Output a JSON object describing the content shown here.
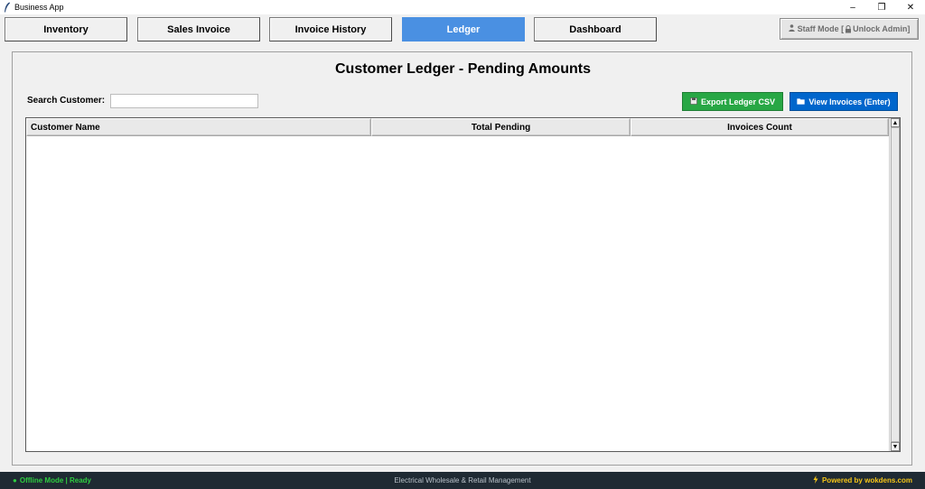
{
  "window": {
    "title": "Business App",
    "controls": {
      "minimize": "–",
      "restore": "❐",
      "close": "✕"
    }
  },
  "nav": {
    "tabs": [
      {
        "label": "Inventory",
        "active": false
      },
      {
        "label": "Sales Invoice",
        "active": false
      },
      {
        "label": "Invoice History",
        "active": false
      },
      {
        "label": "Ledger",
        "active": true
      },
      {
        "label": "Dashboard",
        "active": false
      }
    ],
    "staff_mode_label": "Staff Mode [",
    "unlock_label": " Unlock Admin]"
  },
  "main": {
    "title": "Customer Ledger - Pending Amounts",
    "search": {
      "label": "Search Customer:",
      "value": ""
    },
    "export_label": "Export Ledger CSV",
    "view_label": "View Invoices (Enter)",
    "table": {
      "columns": [
        "Customer Name",
        "Total Pending",
        "Invoices Count"
      ],
      "rows": []
    }
  },
  "footer": {
    "status": "Offline Mode | Ready",
    "center": "Electrical Wholesale & Retail Management",
    "powered": "Powered by wokdens.com"
  },
  "colors": {
    "active_tab": "#4a90e2",
    "export_button": "#28a745",
    "view_button": "#0066cc",
    "footer_bg": "#1f2a33",
    "status_green": "#2ecc40",
    "powered_yellow": "#f5c518"
  },
  "icons": {
    "app": "feather-icon",
    "staff": "person-icon",
    "lock": "lock-icon",
    "export": "save-icon",
    "view": "folder-icon",
    "status": "dot-icon",
    "powered": "lightning-icon"
  }
}
